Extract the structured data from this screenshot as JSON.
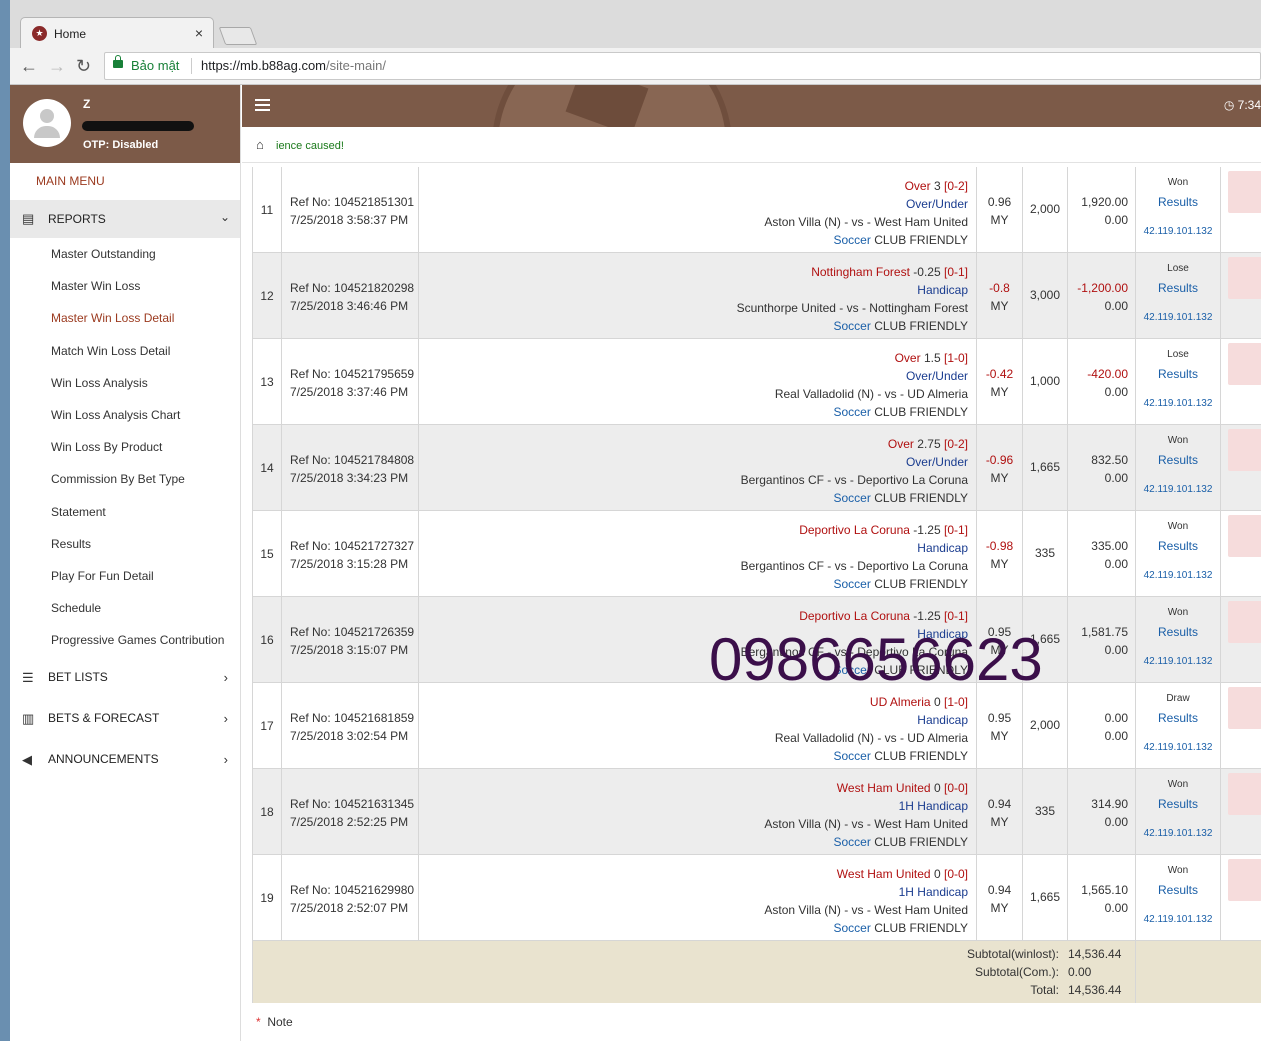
{
  "browser": {
    "tab_title": "Home",
    "tab_close": "×",
    "security_label": "Bảo mật",
    "url_host": "https://mb.b88ag.com",
    "url_path": "/site-main/"
  },
  "profile": {
    "username": "Z",
    "otp": "OTP: Disabled"
  },
  "sidebar": {
    "main_menu": "MAIN MENU",
    "reports_label": "REPORTS",
    "report_items": [
      "Master Outstanding",
      "Master Win Loss",
      "Master Win Loss Detail",
      "Match Win Loss Detail",
      "Win Loss Analysis",
      "Win Loss Analysis Chart",
      "Win Loss By Product",
      "Commission By Bet Type",
      "Statement",
      "Results",
      "Play For Fun Detail",
      "Schedule",
      "Progressive Games Contribution"
    ],
    "bet_lists": "BET LISTS",
    "bets_forecast": "BETS & FORECAST",
    "announcements": "ANNOUNCEMENTS"
  },
  "topbar": {
    "time": "7:34"
  },
  "marquee": "ience caused!",
  "bets": [
    {
      "no": "11",
      "ref": "Ref No: 104521851301",
      "date": "7/25/2018 3:58:37 PM",
      "pick_team": "Over",
      "pick_hdp": "3",
      "pick_score": "[0-2]",
      "bet_type": "Over/Under",
      "match": "Aston Villa (N) - vs - West Ham United",
      "sport": "Soccer",
      "league": "CLUB FRIENDLY",
      "odds": "0.96",
      "odds_type": "MY",
      "stake": "2,000",
      "winloss": "1,920.00",
      "comm": "0.00",
      "status": "Won",
      "results": "Results",
      "ip": "42.119.101.132"
    },
    {
      "no": "12",
      "ref": "Ref No: 104521820298",
      "date": "7/25/2018 3:46:46 PM",
      "pick_team": "Nottingham Forest",
      "pick_hdp": "-0.25",
      "pick_score": "[0-1]",
      "bet_type": "Handicap",
      "match": "Scunthorpe United - vs - Nottingham Forest",
      "sport": "Soccer",
      "league": "CLUB FRIENDLY",
      "odds": "-0.8",
      "odds_type": "MY",
      "stake": "3,000",
      "winloss": "-1,200.00",
      "comm": "0.00",
      "status": "Lose",
      "results": "Results",
      "ip": "42.119.101.132"
    },
    {
      "no": "13",
      "ref": "Ref No: 104521795659",
      "date": "7/25/2018 3:37:46 PM",
      "pick_team": "Over",
      "pick_hdp": "1.5",
      "pick_score": "[1-0]",
      "bet_type": "Over/Under",
      "match": "Real Valladolid (N) - vs - UD Almeria",
      "sport": "Soccer",
      "league": "CLUB FRIENDLY",
      "odds": "-0.42",
      "odds_type": "MY",
      "stake": "1,000",
      "winloss": "-420.00",
      "comm": "0.00",
      "status": "Lose",
      "results": "Results",
      "ip": "42.119.101.132"
    },
    {
      "no": "14",
      "ref": "Ref No: 104521784808",
      "date": "7/25/2018 3:34:23 PM",
      "pick_team": "Over",
      "pick_hdp": "2.75",
      "pick_score": "[0-2]",
      "bet_type": "Over/Under",
      "match": "Bergantinos CF - vs - Deportivo La Coruna",
      "sport": "Soccer",
      "league": "CLUB FRIENDLY",
      "odds": "-0.96",
      "odds_type": "MY",
      "stake": "1,665",
      "winloss": "832.50",
      "comm": "0.00",
      "status": "Won",
      "results": "Results",
      "ip": "42.119.101.132"
    },
    {
      "no": "15",
      "ref": "Ref No: 104521727327",
      "date": "7/25/2018 3:15:28 PM",
      "pick_team": "Deportivo La Coruna",
      "pick_hdp": "-1.25",
      "pick_score": "[0-1]",
      "bet_type": "Handicap",
      "match": "Bergantinos CF - vs - Deportivo La Coruna",
      "sport": "Soccer",
      "league": "CLUB FRIENDLY",
      "odds": "-0.98",
      "odds_type": "MY",
      "stake": "335",
      "winloss": "335.00",
      "comm": "0.00",
      "status": "Won",
      "results": "Results",
      "ip": "42.119.101.132"
    },
    {
      "no": "16",
      "ref": "Ref No: 104521726359",
      "date": "7/25/2018 3:15:07 PM",
      "pick_team": "Deportivo La Coruna",
      "pick_hdp": "-1.25",
      "pick_score": "[0-1]",
      "bet_type": "Handicap",
      "match": "Bergantinos CF - vs - Deportivo La Coruna",
      "sport": "Soccer",
      "league": "CLUB FRIENDLY",
      "odds": "0.95",
      "odds_type": "MY",
      "stake": "1,665",
      "winloss": "1,581.75",
      "comm": "0.00",
      "status": "Won",
      "results": "Results",
      "ip": "42.119.101.132"
    },
    {
      "no": "17",
      "ref": "Ref No: 104521681859",
      "date": "7/25/2018 3:02:54 PM",
      "pick_team": "UD Almeria",
      "pick_hdp": "0",
      "pick_score": "[1-0]",
      "bet_type": "Handicap",
      "match": "Real Valladolid (N) - vs - UD Almeria",
      "sport": "Soccer",
      "league": "CLUB FRIENDLY",
      "odds": "0.95",
      "odds_type": "MY",
      "stake": "2,000",
      "winloss": "0.00",
      "comm": "0.00",
      "status": "Draw",
      "results": "Results",
      "ip": "42.119.101.132"
    },
    {
      "no": "18",
      "ref": "Ref No: 104521631345",
      "date": "7/25/2018 2:52:25 PM",
      "pick_team": "West Ham United",
      "pick_hdp": "0",
      "pick_score": "[0-0]",
      "bet_type": "1H Handicap",
      "match": "Aston Villa (N) - vs - West Ham United",
      "sport": "Soccer",
      "league": "CLUB FRIENDLY",
      "odds": "0.94",
      "odds_type": "MY",
      "stake": "335",
      "winloss": "314.90",
      "comm": "0.00",
      "status": "Won",
      "results": "Results",
      "ip": "42.119.101.132"
    },
    {
      "no": "19",
      "ref": "Ref No: 104521629980",
      "date": "7/25/2018 2:52:07 PM",
      "pick_team": "West Ham United",
      "pick_hdp": "0",
      "pick_score": "[0-0]",
      "bet_type": "1H Handicap",
      "match": "Aston Villa (N) - vs - West Ham United",
      "sport": "Soccer",
      "league": "CLUB FRIENDLY",
      "odds": "0.94",
      "odds_type": "MY",
      "stake": "1,665",
      "winloss": "1,565.10",
      "comm": "0.00",
      "status": "Won",
      "results": "Results",
      "ip": "42.119.101.132"
    }
  ],
  "subtotal": {
    "winlost_label": "Subtotal(winlost):",
    "winlost_value": "14,536.44",
    "com_label": "Subtotal(Com.):",
    "com_value": "0.00",
    "total_label": "Total:",
    "total_value": "14,536.44"
  },
  "note": "Note",
  "watermark": "0986656623"
}
